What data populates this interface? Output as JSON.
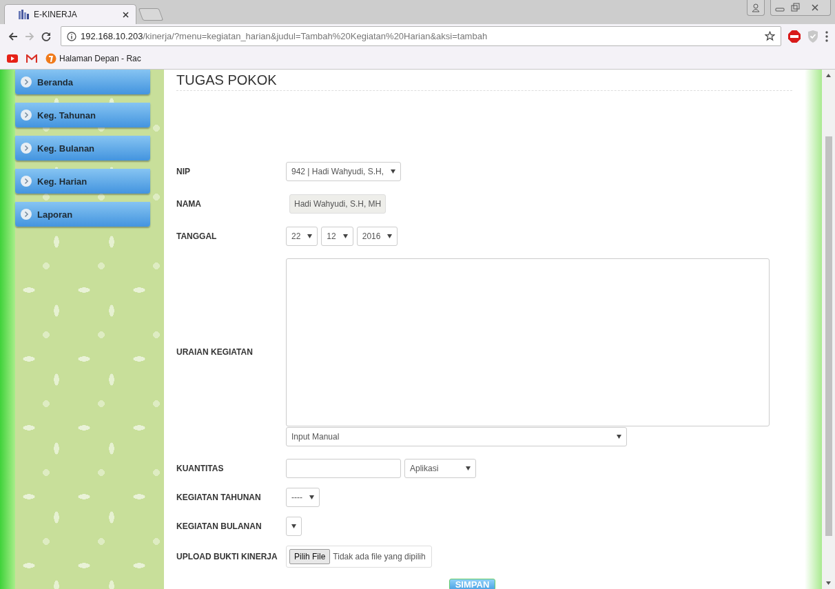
{
  "browser": {
    "tab": {
      "title": "E-KINERJA"
    },
    "url": {
      "host": "192.168.10.203",
      "path": "/kinerja/?menu=kegiatan_harian&judul=Tambah%20Kegiatan%20Harian&aksi=tambah"
    },
    "bookmarks": [
      "Halaman Depan - Rac"
    ]
  },
  "sidebar": {
    "items": [
      "Beranda",
      "Keg. Tahunan",
      "Keg. Bulanan",
      "Keg. Harian",
      "Laporan"
    ]
  },
  "form": {
    "title": "TUGAS POKOK",
    "fields": [
      {
        "label": "NIP",
        "kind": "select",
        "value": "942 | Hadi Wahyudi, S.H,"
      },
      {
        "label": "NAMA",
        "kind": "readonly",
        "value": "Hadi Wahyudi, S.H, MH"
      },
      {
        "label": "TANGGAL",
        "kind": "date",
        "values": [
          "22",
          "12",
          "2016"
        ]
      },
      {
        "label": "URAIAN KEGIATAN",
        "kind": "textarea",
        "source": "Input Manual"
      },
      {
        "label": "KUANTITAS",
        "kind": "quantity",
        "unit": "Aplikasi"
      },
      {
        "label": "KEGIATAN TAHUNAN",
        "kind": "select",
        "value": "----"
      },
      {
        "label": "KEGIATAN BULANAN",
        "kind": "select"
      },
      {
        "label": "UPLOAD BUKTI KINERJA",
        "kind": "file",
        "button": "Pilih File",
        "status": "Tidak ada file yang dipilih"
      }
    ],
    "submit": "SIMPAN"
  }
}
